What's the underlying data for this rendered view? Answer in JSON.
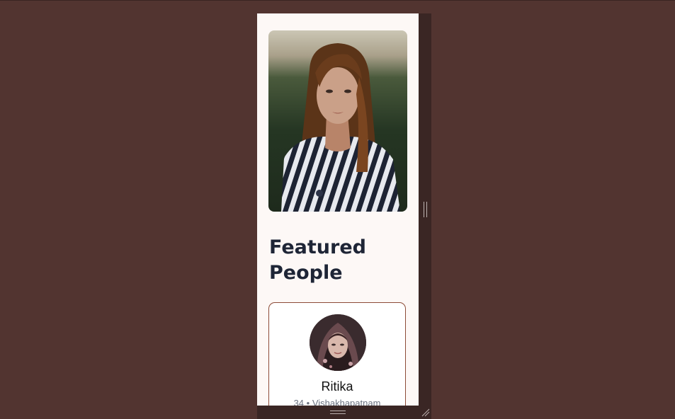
{
  "hero": {
    "alt": "Woman in striped shirt portrait"
  },
  "section": {
    "heading": "Featured People"
  },
  "card": {
    "name": "Ritika",
    "meta": "34 • Vishakhapatnam"
  },
  "icons": {
    "vertical_handle": "vertical-drag-handle-icon",
    "horizontal_handle": "horizontal-drag-handle-icon",
    "resize_grip": "resize-grip-icon"
  },
  "colors": {
    "page_background": "#523430",
    "panel_background": "#fdf8f6",
    "heading_text": "#1e2536",
    "card_border": "#8d4b37",
    "meta_text": "#6b7280"
  }
}
